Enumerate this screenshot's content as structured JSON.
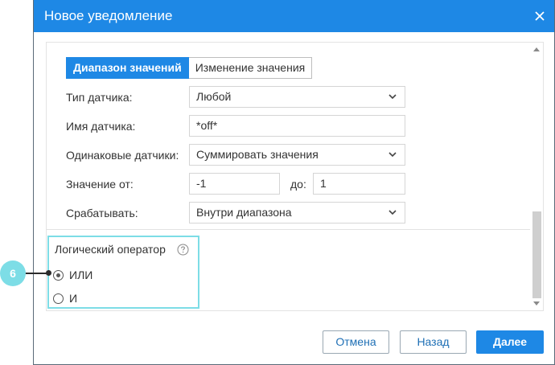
{
  "dialog": {
    "title": "Новое уведомление"
  },
  "tabs": [
    {
      "label": "Диапазон значений",
      "active": true
    },
    {
      "label": "Изменение значения",
      "active": false
    }
  ],
  "form": {
    "sensor_type": {
      "label": "Тип датчика:",
      "value": "Любой"
    },
    "sensor_name": {
      "label": "Имя датчика:",
      "value": "*off*"
    },
    "same_sensors": {
      "label": "Одинаковые датчики:",
      "value": "Суммировать значения"
    },
    "value_from": {
      "label": "Значение от:",
      "value": "-1"
    },
    "value_to": {
      "label": "до:",
      "value": "1"
    },
    "trigger": {
      "label": "Срабатывать:",
      "value": "Внутри диапазона"
    }
  },
  "logic": {
    "title": "Логический оператор",
    "options": [
      {
        "label": "ИЛИ",
        "checked": true
      },
      {
        "label": "И",
        "checked": false
      }
    ]
  },
  "callout": {
    "number": "6"
  },
  "buttons": {
    "cancel": "Отмена",
    "back": "Назад",
    "next": "Далее"
  },
  "colors": {
    "accent": "#1e88e5",
    "highlight": "#7ddde6"
  }
}
